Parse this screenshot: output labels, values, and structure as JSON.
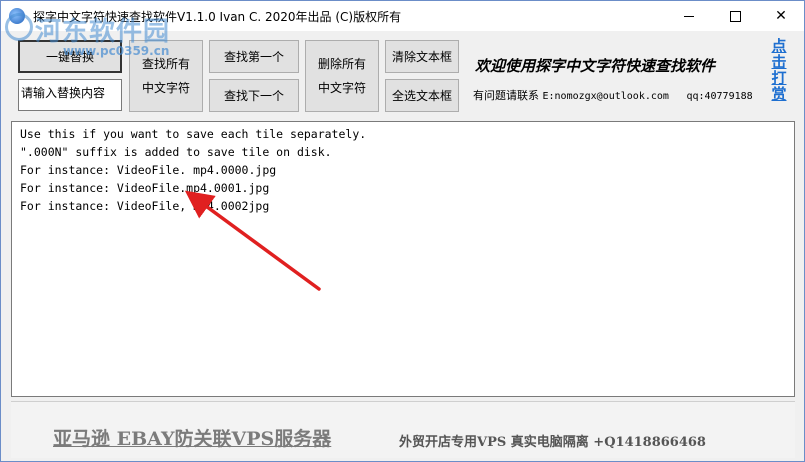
{
  "window": {
    "title": "探字中文字符快速查找软件V1.1.0   Ivan C. 2020年出品 (C)版权所有"
  },
  "watermark": {
    "name": "河东软件园",
    "url": "www.pc0359.cn"
  },
  "toolbar": {
    "replace_all_label": "一键替换",
    "find_all_label_1": "查找所有",
    "find_all_label_2": "中文字符",
    "find_first_label": "查找第一个",
    "find_next_label": "查找下一个",
    "delete_all_label_1": "删除所有",
    "delete_all_label_2": "中文字符",
    "clear_text_label": "清除文本框",
    "select_all_label": "全选文本框",
    "replace_input_value": "请输入替换内容"
  },
  "banner": {
    "welcome": "欢迎使用探字中文字符快速查找软件",
    "contact_prefix": "有问题请联系 ",
    "email": "E:nomozgx@outlook.com",
    "qq": "qq:40779188",
    "reward_link": "点击打赏"
  },
  "editor": {
    "lines": [
      "Use this if you want to save each tile separately.",
      "\".000N\" suffix is added to save tile on disk.",
      "For instance: VideoFile. mp4.0000.jpg",
      "For instance: VideoFile.mp4.0001.jpg",
      "For instance: VideoFile, mp4.0002jpg"
    ]
  },
  "ad": {
    "main": "亚马逊  EBAY防关联VPS服务器",
    "sub": "外贸开店专用VPS  真实电脑隔离  +Q1418866468"
  },
  "colors": {
    "arrow": "#e02020",
    "link": "#1e6fd0"
  }
}
